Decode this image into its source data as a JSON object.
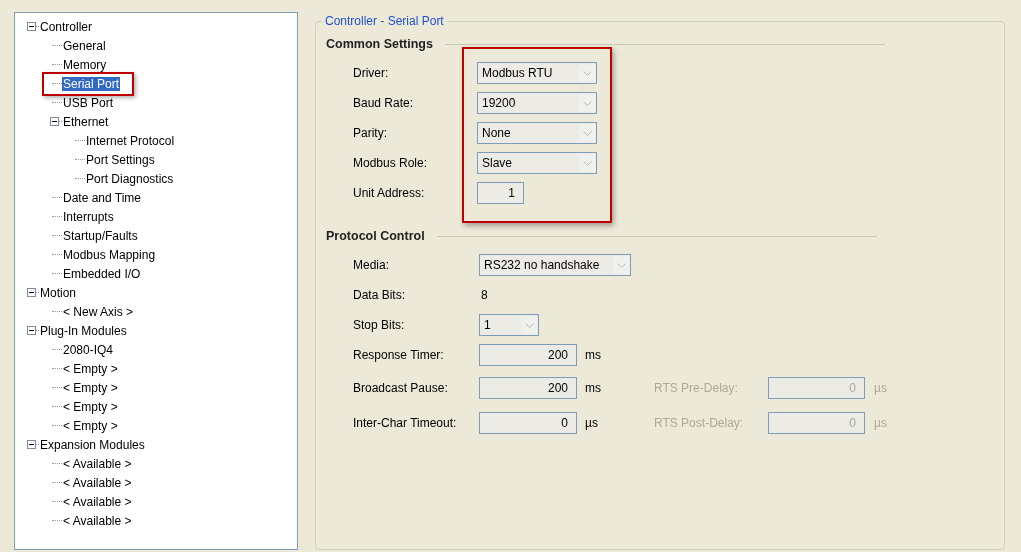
{
  "tree": [
    {
      "label": "Controller",
      "expanded": true,
      "selected": false,
      "children": [
        {
          "label": "General",
          "selected": false
        },
        {
          "label": "Memory",
          "selected": false
        },
        {
          "label": "Serial Port",
          "selected": true,
          "highlighted": true
        },
        {
          "label": "USB Port",
          "selected": false
        },
        {
          "label": "Ethernet",
          "expanded": true,
          "selected": false,
          "children": [
            {
              "label": "Internet Protocol",
              "selected": false
            },
            {
              "label": "Port Settings",
              "selected": false
            },
            {
              "label": "Port Diagnostics",
              "selected": false
            }
          ]
        },
        {
          "label": "Date and Time",
          "selected": false
        },
        {
          "label": "Interrupts",
          "selected": false
        },
        {
          "label": "Startup/Faults",
          "selected": false
        },
        {
          "label": "Modbus Mapping",
          "selected": false
        },
        {
          "label": "Embedded I/O",
          "selected": false
        }
      ]
    },
    {
      "label": "Motion",
      "expanded": true,
      "selected": false,
      "children": [
        {
          "label": "< New Axis >",
          "selected": false
        }
      ]
    },
    {
      "label": "Plug-In Modules",
      "expanded": true,
      "selected": false,
      "children": [
        {
          "label": "2080-IQ4",
          "selected": false
        },
        {
          "label": "< Empty >",
          "selected": false
        },
        {
          "label": "< Empty >",
          "selected": false
        },
        {
          "label": "< Empty >",
          "selected": false
        },
        {
          "label": "< Empty >",
          "selected": false
        }
      ]
    },
    {
      "label": "Expansion Modules",
      "expanded": true,
      "selected": false,
      "children": [
        {
          "label": "< Available >",
          "selected": false
        },
        {
          "label": "< Available >",
          "selected": false
        },
        {
          "label": "< Available >",
          "selected": false
        },
        {
          "label": "< Available >",
          "selected": false
        }
      ]
    }
  ],
  "panel": {
    "title": "Controller - Serial Port",
    "sections": [
      {
        "title": "Common Settings",
        "highlighted": true,
        "rows": [
          {
            "label": "Driver:",
            "kind": "dropdown",
            "value": "Modbus RTU"
          },
          {
            "label": "Baud Rate:",
            "kind": "dropdown",
            "value": "19200"
          },
          {
            "label": "Parity:",
            "kind": "dropdown",
            "value": "None"
          },
          {
            "label": "Modbus Role:",
            "kind": "dropdown",
            "value": "Slave"
          },
          {
            "label": "Unit Address:",
            "kind": "number",
            "value": "1"
          }
        ]
      },
      {
        "title": "Protocol Control",
        "highlighted": false,
        "rows": [
          {
            "label": "Media:",
            "kind": "dropdown",
            "value": "RS232 no handshake",
            "wide": true
          },
          {
            "label": "Data Bits:",
            "kind": "static",
            "value": "8"
          },
          {
            "label": "Stop Bits:",
            "kind": "dropdown",
            "value": "1"
          },
          {
            "label": "Response Timer:",
            "kind": "number",
            "value": "200",
            "unit": "ms"
          },
          {
            "label": "Broadcast Pause:",
            "kind": "number",
            "value": "200",
            "unit": "ms",
            "side": {
              "label": "RTS Pre-Delay:",
              "value": "0",
              "unit": "µs",
              "disabled": true
            }
          },
          {
            "label": "Inter-Char Timeout:",
            "kind": "number",
            "value": "0",
            "unit": "µs",
            "side": {
              "label": "RTS Post-Delay:",
              "value": "0",
              "unit": "µs",
              "disabled": true
            }
          }
        ]
      }
    ]
  }
}
